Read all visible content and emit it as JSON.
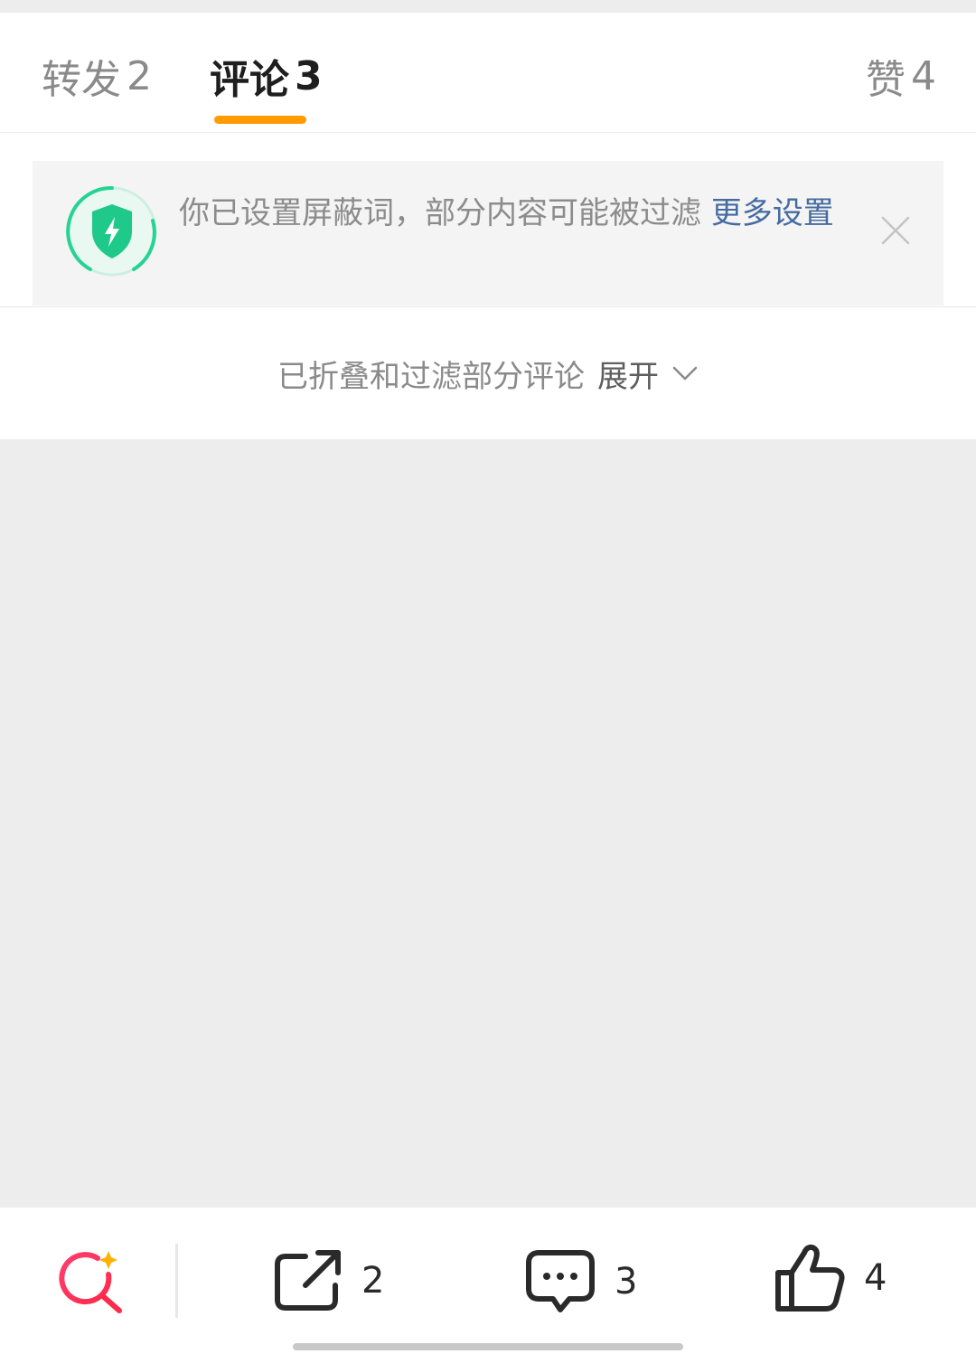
{
  "tabs": {
    "repost": {
      "label": "转发",
      "count": "2"
    },
    "comments": {
      "label": "评论",
      "count": "3"
    },
    "likes": {
      "label": "赞",
      "count": "4"
    }
  },
  "notice": {
    "message": "你已设置屏蔽词，部分内容可能被过滤 ",
    "link": "更多设置"
  },
  "fold": {
    "message": "已折叠和过滤部分评论",
    "expand": "展开"
  },
  "bottom_bar": {
    "repost_count": "2",
    "comment_count": "3",
    "like_count": "4"
  },
  "colors": {
    "tab_indicator": "#ff9a00",
    "link": "#466ba0",
    "shield": "#1ec98a"
  },
  "icons": {
    "notice": "shield-lightning-icon",
    "close": "close-icon",
    "expand": "chevron-down-icon",
    "search": "search-sparkle-icon",
    "repost": "share-arrow-icon",
    "comment": "comment-bubble-icon",
    "like": "thumbs-up-icon"
  }
}
